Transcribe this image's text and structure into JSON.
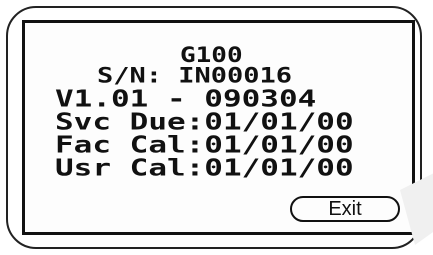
{
  "screen": {
    "model": "G100",
    "serial_line": "S/N: IN00016",
    "version_line": "V1.01 - 090304",
    "service_due_line": "Svc Due:01/01/00",
    "factory_cal_line": "Fac Cal:01/01/00",
    "user_cal_line": "Usr Cal:01/01/00"
  },
  "buttons": {
    "exit_label": "Exit"
  },
  "colors": {
    "lcd_text": "#111111",
    "lcd_background": "#fdfdfd",
    "frame_border": "#222222"
  }
}
